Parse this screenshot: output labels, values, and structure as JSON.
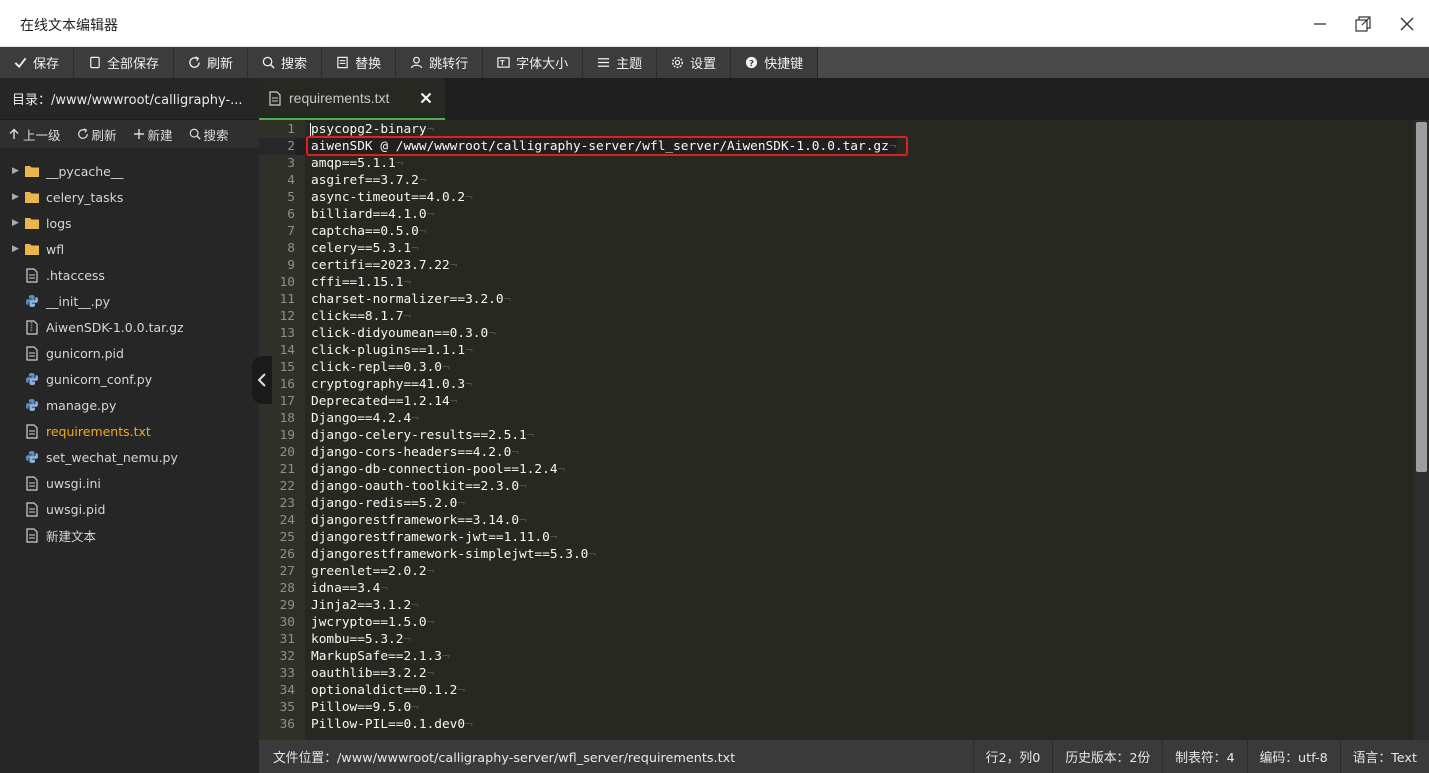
{
  "window": {
    "title": "在线文本编辑器"
  },
  "toolbar": {
    "save": "保存",
    "save_all": "全部保存",
    "refresh": "刷新",
    "search": "搜索",
    "replace": "替换",
    "goto_line": "跳转行",
    "font_size": "字体大小",
    "theme": "主题",
    "settings": "设置",
    "shortcuts": "快捷键"
  },
  "sidebar": {
    "path": "目录：/www/wwwroot/calligraphy-...",
    "actions": {
      "up": "上一级",
      "refresh": "刷新",
      "new": "新建",
      "search": "搜索"
    },
    "items": [
      {
        "label": "__pycache__",
        "type": "folder"
      },
      {
        "label": "celery_tasks",
        "type": "folder"
      },
      {
        "label": "logs",
        "type": "folder"
      },
      {
        "label": "wfl",
        "type": "folder"
      },
      {
        "label": ".htaccess",
        "type": "file"
      },
      {
        "label": "__init__.py",
        "type": "python"
      },
      {
        "label": "AiwenSDK-1.0.0.tar.gz",
        "type": "archive"
      },
      {
        "label": "gunicorn.pid",
        "type": "file"
      },
      {
        "label": "gunicorn_conf.py",
        "type": "python"
      },
      {
        "label": "manage.py",
        "type": "python"
      },
      {
        "label": "requirements.txt",
        "type": "file",
        "active": true
      },
      {
        "label": "set_wechat_nemu.py",
        "type": "python"
      },
      {
        "label": "uwsgi.ini",
        "type": "file"
      },
      {
        "label": "uwsgi.pid",
        "type": "file"
      },
      {
        "label": "新建文本",
        "type": "file"
      }
    ]
  },
  "editor": {
    "tab_label": "requirements.txt",
    "current_line": 2,
    "lines": [
      "psycopg2-binary",
      "aiwenSDK @ /www/wwwroot/calligraphy-server/wfl_server/AiwenSDK-1.0.0.tar.gz",
      "amqp==5.1.1",
      "asgiref==3.7.2",
      "async-timeout==4.0.2",
      "billiard==4.1.0",
      "captcha==0.5.0",
      "celery==5.3.1",
      "certifi==2023.7.22",
      "cffi==1.15.1",
      "charset-normalizer==3.2.0",
      "click==8.1.7",
      "click-didyoumean==0.3.0",
      "click-plugins==1.1.1",
      "click-repl==0.3.0",
      "cryptography==41.0.3",
      "Deprecated==1.2.14",
      "Django==4.2.4",
      "django-celery-results==2.5.1",
      "django-cors-headers==4.2.0",
      "django-db-connection-pool==1.2.4",
      "django-oauth-toolkit==2.3.0",
      "django-redis==5.2.0",
      "djangorestframework==3.14.0",
      "djangorestframework-jwt==1.11.0",
      "djangorestframework-simplejwt==5.3.0",
      "greenlet==2.0.2",
      "idna==3.4",
      "Jinja2==3.1.2",
      "jwcrypto==1.5.0",
      "kombu==5.3.2",
      "MarkupSafe==2.1.3",
      "oauthlib==3.2.2",
      "optionaldict==0.1.2",
      "Pillow==9.5.0",
      "Pillow-PIL==0.1.dev0"
    ]
  },
  "status": {
    "file_path": "文件位置：/www/wwwroot/calligraphy-server/wfl_server/requirements.txt",
    "position": "行2，列0",
    "history": "历史版本：2份",
    "tab_size": "制表符：4",
    "encoding": "编码：utf-8",
    "language": "语言：Text"
  },
  "colors": {
    "accent": "#4caf50",
    "active_file": "#f5a623",
    "highlight_box": "#e02020",
    "folder": "#e8b64c",
    "python": "#5b8fc7"
  }
}
